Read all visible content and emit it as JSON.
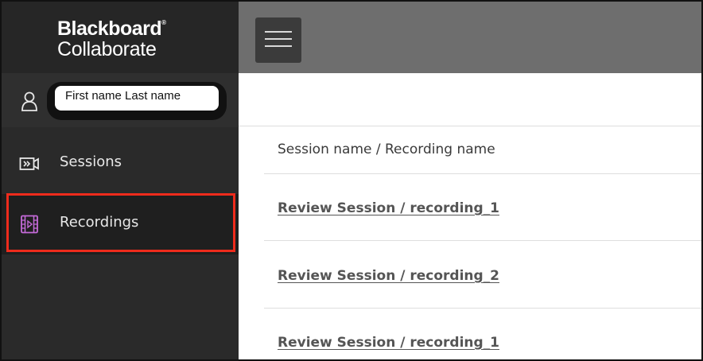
{
  "brand": {
    "line1": "Blackboard",
    "trademark": "®",
    "line2": "Collaborate"
  },
  "user": {
    "name": "First name Last name",
    "icon": "user-icon"
  },
  "sidebar": {
    "items": [
      {
        "label": "Sessions",
        "icon": "sessions-icon",
        "selected": false
      },
      {
        "label": "Recordings",
        "icon": "recordings-icon",
        "selected": true
      }
    ]
  },
  "topbar": {
    "menu_icon": "hamburger-menu-icon"
  },
  "table": {
    "header": "Session name / Recording name",
    "rows": [
      {
        "label": "Review Session / recording_1"
      },
      {
        "label": "Review Session / recording_2"
      },
      {
        "label": "Review Session / recording_1"
      }
    ]
  },
  "colors": {
    "sidebar_bg": "#2a2a2a",
    "topbar_bg": "#6e6e6e",
    "highlight": "#ee2b1c",
    "recordings_icon": "#c46ad8"
  }
}
